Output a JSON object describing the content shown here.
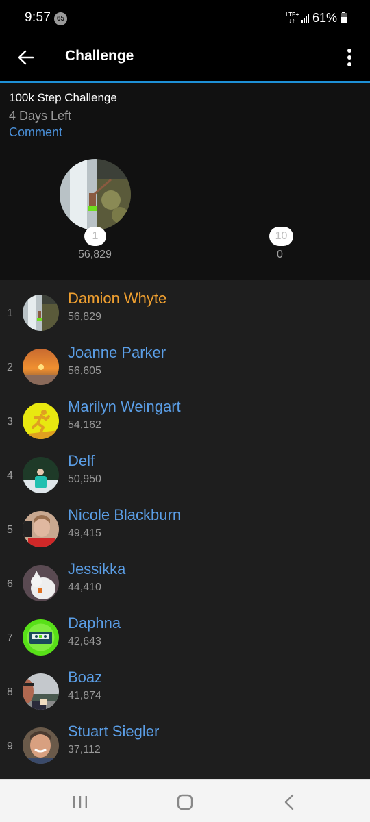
{
  "status_bar": {
    "time": "9:57",
    "notification_badge": "65",
    "network": "LTE+",
    "battery_percent": "61%"
  },
  "app_bar": {
    "title": "Challenge",
    "back_icon": "arrow-left-icon",
    "menu_icon": "more-vertical-icon"
  },
  "challenge": {
    "name": "100k Step Challenge",
    "time_left": "4 Days Left",
    "comment_label": "Comment",
    "progress": {
      "leader_rank": "1",
      "leader_steps": "56,829",
      "last_rank": "10",
      "last_steps": "0"
    }
  },
  "colors": {
    "accent": "#1e90d6",
    "leader_name": "#f0a030",
    "name": "#5b9ee6"
  },
  "leaderboard": [
    {
      "rank": "1",
      "name": "Damion Whyte",
      "steps": "56,829",
      "avatar": "waterfall-photo"
    },
    {
      "rank": "2",
      "name": "Joanne Parker",
      "steps": "56,605",
      "avatar": "sunset-photo"
    },
    {
      "rank": "3",
      "name": "Marilyn Weingart",
      "steps": "54,162",
      "avatar": "runner-icon"
    },
    {
      "rank": "4",
      "name": "Delf",
      "steps": "50,950",
      "avatar": "person-in-snow-photo"
    },
    {
      "rank": "5",
      "name": "Nicole Blackburn",
      "steps": "49,415",
      "avatar": "woman-portrait-photo"
    },
    {
      "rank": "6",
      "name": "Jessikka",
      "steps": "44,410",
      "avatar": "white-dog-photo"
    },
    {
      "rank": "7",
      "name": "Daphna",
      "steps": "42,643",
      "avatar": "cassette-icon"
    },
    {
      "rank": "8",
      "name": "Boaz",
      "steps": "41,874",
      "avatar": "man-with-glasses-photo"
    },
    {
      "rank": "9",
      "name": "Stuart Siegler",
      "steps": "37,112",
      "avatar": "man-portrait-photo"
    }
  ],
  "nav_bar": {
    "recents_icon": "recents-icon",
    "home_icon": "home-icon",
    "back_icon": "back-icon"
  }
}
